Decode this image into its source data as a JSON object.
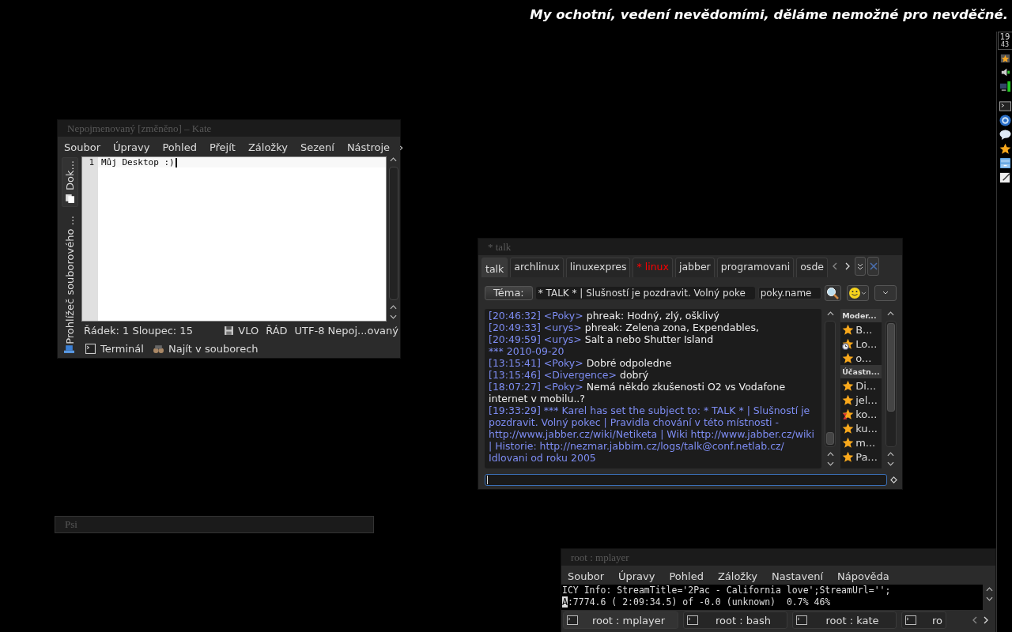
{
  "motto": "My ochotní, vedení nevědomími, děláme nemožné pro nevděčné.",
  "panel": {
    "clock_hour": "19",
    "clock_minute": "43"
  },
  "kate": {
    "title": "Nepojmenovaný [změněno] – Kate",
    "menu": [
      "Soubor",
      "Úpravy",
      "Pohled",
      "Přejít",
      "Záložky",
      "Sezení",
      "Nástroje"
    ],
    "menu_more": "›",
    "sidebar_tabs": [
      "Dok...",
      "Prohlížeč souborového ..."
    ],
    "line_number": "1",
    "text": "Můj Desktop :)",
    "status": {
      "position": "Řádek: 1 Sloupec: 15",
      "mode": "VLO",
      "selection": "ŘÁD",
      "encoding": "UTF-8",
      "document": "Nepoj...ovaný"
    },
    "tools": [
      "Terminál",
      "Najít v souborech"
    ]
  },
  "talk": {
    "title": "* talk",
    "tabs": [
      {
        "label": "talk",
        "selected": true,
        "unread": false
      },
      {
        "label": "archlinux",
        "selected": false,
        "unread": false
      },
      {
        "label": "linuxexpres",
        "selected": false,
        "unread": false
      },
      {
        "label": "* linux",
        "selected": false,
        "unread": true
      },
      {
        "label": "jabber",
        "selected": false,
        "unread": false
      },
      {
        "label": "programovani",
        "selected": false,
        "unread": false
      },
      {
        "label": "osde",
        "selected": false,
        "unread": false
      }
    ],
    "topic_button": "Téma:",
    "topic": "* TALK * | Slušností je pozdravit. Volný poke",
    "nick": "poky.name",
    "messages": [
      {
        "kind": "msg",
        "time": "[20:46:32]",
        "nick": "<Poky>",
        "text": "phreak: Hodný, zlý, ošklivý"
      },
      {
        "kind": "msg",
        "time": "[20:49:33]",
        "nick": "<urys>",
        "text": "phreak: Zelena zona, Expendables,"
      },
      {
        "kind": "msg",
        "time": "[20:49:59]",
        "nick": "<urys>",
        "text": "Salt a nebo Shutter Island"
      },
      {
        "kind": "date",
        "text": "*** 2010-09-20"
      },
      {
        "kind": "msg",
        "time": "[13:15:41]",
        "nick": "<Poky>",
        "text": "Dobré odpoledne"
      },
      {
        "kind": "msg",
        "time": "[13:15:46]",
        "nick": "<Divergence>",
        "text": "dobrý"
      },
      {
        "kind": "msg",
        "time": "[18:07:27]",
        "nick": "<Poky>",
        "text": "Nemá někdo zkušenosti O2 vs Vodafone internet v mobilu..?"
      },
      {
        "kind": "system",
        "time": "[19:33:29]",
        "text": "*** Karel has set the subject to: * TALK * | Slušností je pozdravit. Volný pokec | Pravidla chování v této místnosti - http://www.jabber.cz/wiki/Netiketa | Wiki http://www.jabber.cz/wiki | Historie: http://nezmar.jabbim.cz/logs/talk@conf.netlab.cz/ Idlovani od roku 2005"
      }
    ],
    "roster": [
      {
        "group": "Moder...",
        "members": [
          {
            "name": "B...",
            "kind": "online"
          },
          {
            "name": "Lo...",
            "kind": "away"
          },
          {
            "name": "o...",
            "kind": "online"
          }
        ]
      },
      {
        "group": "Účastn...",
        "members": [
          {
            "name": "Di...",
            "kind": "online"
          },
          {
            "name": "jel...",
            "kind": "online"
          },
          {
            "name": "ko...",
            "kind": "busy"
          },
          {
            "name": "ku...",
            "kind": "online"
          },
          {
            "name": "m...",
            "kind": "online"
          },
          {
            "name": "Pa...",
            "kind": "online"
          }
        ]
      }
    ]
  },
  "psi": {
    "title": "Psi"
  },
  "terminal": {
    "title": "root : mplayer",
    "menu": [
      "Soubor",
      "Úpravy",
      "Pohled",
      "Záložky",
      "Nastavení",
      "Nápověda"
    ],
    "lines": [
      {
        "text": "ICY Info: StreamTitle='2Pac - California love';StreamUrl='';",
        "cursor": false
      },
      {
        "text": "A:7774.6 ( 2:09:34.5) of -0.0 (unknown)  0.7% 46%",
        "cursor": true
      }
    ],
    "tabs": [
      {
        "label": "root : mplayer",
        "selected": true
      },
      {
        "label": "root : bash",
        "selected": false
      },
      {
        "label": "root : kate",
        "selected": false
      },
      {
        "label": "ro",
        "selected": false
      }
    ]
  }
}
